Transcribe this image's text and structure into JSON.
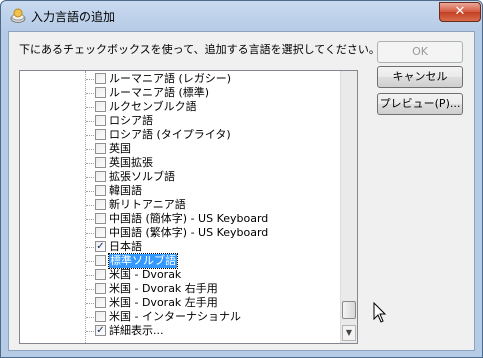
{
  "window": {
    "title": "入力言語の追加",
    "close_glyph": "✕"
  },
  "instruction": "下にあるチェックボックスを使って、追加する言語を選択してください。",
  "buttons": {
    "ok": "OK",
    "cancel": "キャンセル",
    "preview": "プレビュー(P)..."
  },
  "list": {
    "items": [
      {
        "label": "ルーマニア語 (レガシー)",
        "checked": false,
        "selected": false
      },
      {
        "label": "ルーマニア語 (標準)",
        "checked": false,
        "selected": false
      },
      {
        "label": "ルクセンブルク語",
        "checked": false,
        "selected": false
      },
      {
        "label": "ロシア語",
        "checked": false,
        "selected": false
      },
      {
        "label": "ロシア語 (タイプライタ)",
        "checked": false,
        "selected": false
      },
      {
        "label": "英国",
        "checked": false,
        "selected": false
      },
      {
        "label": "英国拡張",
        "checked": false,
        "selected": false
      },
      {
        "label": "拡張ソルブ語",
        "checked": false,
        "selected": false
      },
      {
        "label": "韓国語",
        "checked": false,
        "selected": false
      },
      {
        "label": "新リトアニア語",
        "checked": false,
        "selected": false
      },
      {
        "label": "中国語 (簡体字) - US Keyboard",
        "checked": false,
        "selected": false
      },
      {
        "label": "中国語 (繁体字) - US Keyboard",
        "checked": false,
        "selected": false
      },
      {
        "label": "日本語",
        "checked": true,
        "selected": false
      },
      {
        "label": "標準ソルブ語",
        "checked": false,
        "selected": true
      },
      {
        "label": "米国 - Dvorak",
        "checked": false,
        "selected": false
      },
      {
        "label": "米国 - Dvorak 右手用",
        "checked": false,
        "selected": false
      },
      {
        "label": "米国 - Dvorak 左手用",
        "checked": false,
        "selected": false
      },
      {
        "label": "米国 - インターナショナル",
        "checked": false,
        "selected": false
      },
      {
        "label": "詳細表示...",
        "checked": true,
        "selected": false
      }
    ]
  },
  "icons": {
    "title": "keyboard-globe-icon",
    "cursor": "mouse-pointer-icon",
    "scroll_down": "chevron-down-icon"
  }
}
